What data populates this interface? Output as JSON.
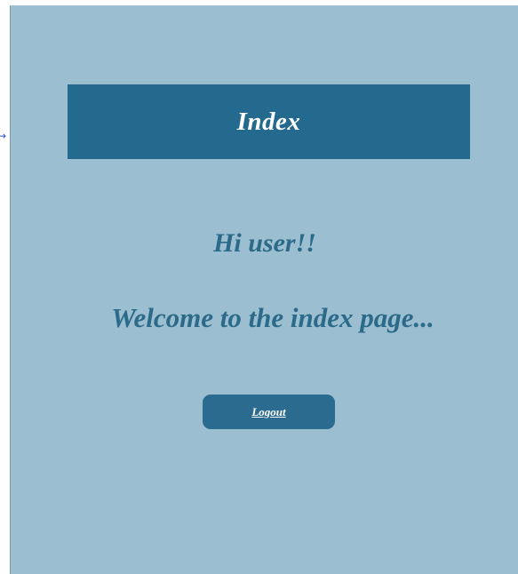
{
  "header": {
    "title": "Index"
  },
  "main": {
    "greeting": "Hi user!!",
    "welcome": "Welcome to the index page..."
  },
  "actions": {
    "logout_label": "Logout"
  },
  "colors": {
    "panel_background": "#9bbfd0",
    "header_background": "#236a8e",
    "heading_text": "#2c6a8a",
    "button_background": "#2b6b8f"
  }
}
